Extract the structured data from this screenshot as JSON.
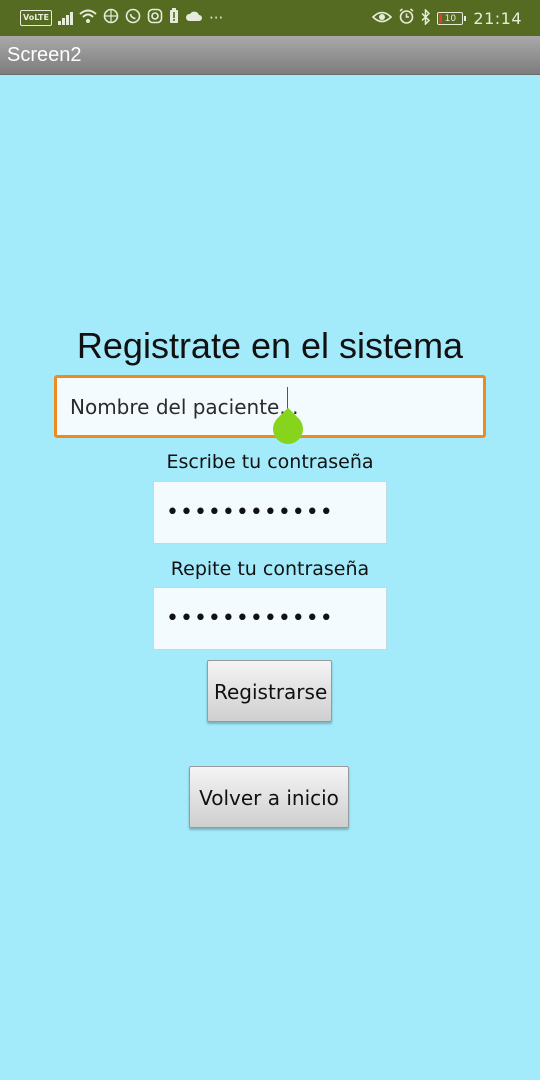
{
  "status_bar": {
    "volte": "VoLTE",
    "battery_level": "10",
    "clock": "21:14",
    "icons_left": [
      "signal-icon",
      "wifi-icon",
      "basketball-icon",
      "whatsapp-icon",
      "instagram-icon",
      "battery-alert-icon",
      "cloud-icon",
      "more-icon"
    ],
    "icons_right": [
      "eye-icon",
      "alarm-icon",
      "bluetooth-icon",
      "battery-icon"
    ]
  },
  "app_bar": {
    "title": "Screen2"
  },
  "form": {
    "heading": "Registrate en el sistema",
    "name_placeholder": "Nombre del paciente...",
    "password_label": "Escribe tu contraseña",
    "password_value": "••••••••••••",
    "repeat_label": "Repite tu contraseña",
    "repeat_value": "••••••••••••",
    "register_button": "Registrarse",
    "back_button": "Volver a inicio"
  },
  "colors": {
    "background": "#a3ebfb",
    "status_bar": "#556b22",
    "focus_border": "#ef8a1e",
    "caret_handle": "#86d41c"
  }
}
